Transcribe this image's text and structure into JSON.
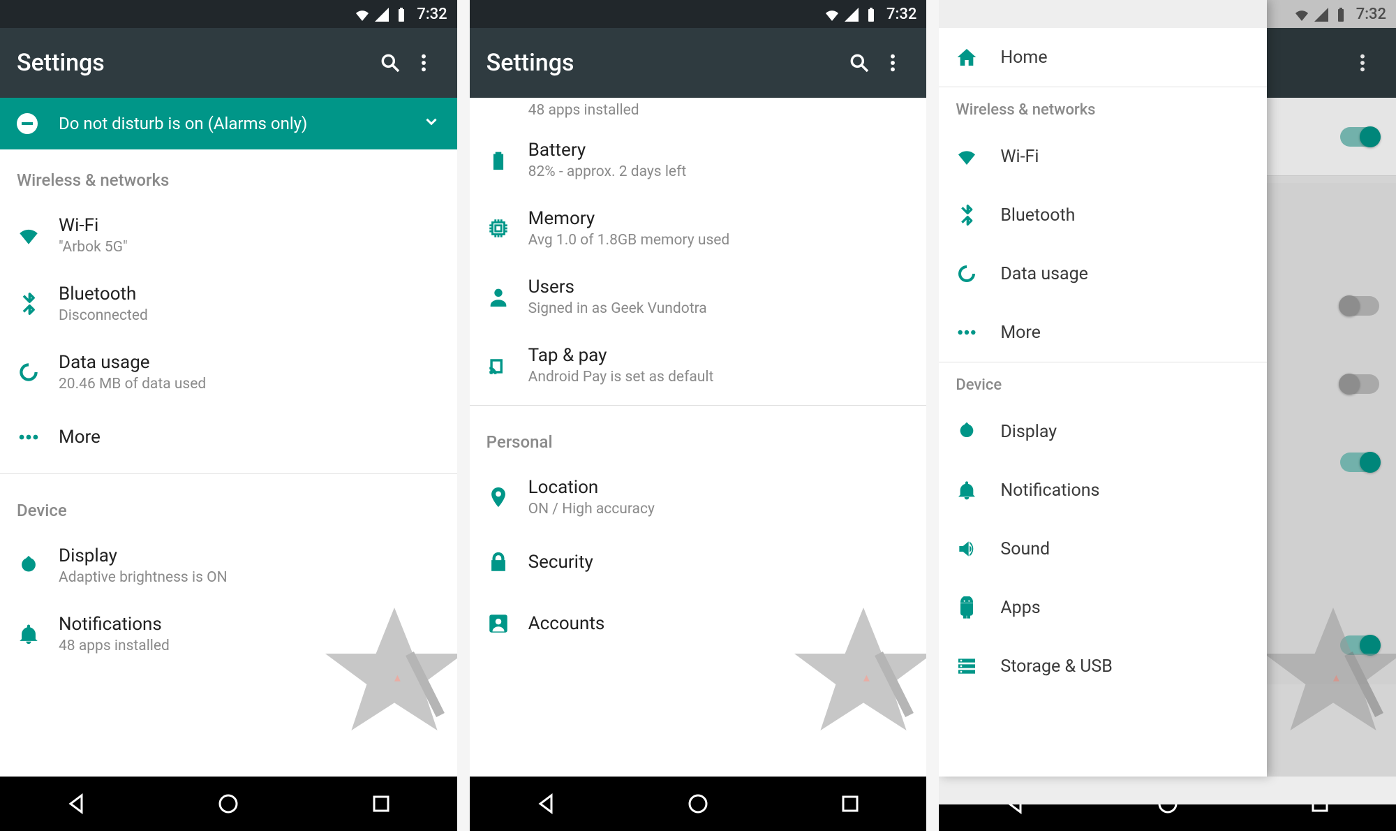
{
  "status": {
    "time": "7:32"
  },
  "appbar": {
    "title": "Settings"
  },
  "dnd": {
    "text": "Do not disturb is on (Alarms only)"
  },
  "p1": {
    "sections": {
      "wireless": "Wireless & networks",
      "device": "Device"
    },
    "wifi": {
      "title": "Wi-Fi",
      "sub": "\"Arbok 5G\""
    },
    "bt": {
      "title": "Bluetooth",
      "sub": "Disconnected"
    },
    "data": {
      "title": "Data usage",
      "sub": "20.46 MB of data used"
    },
    "more": {
      "title": "More"
    },
    "display": {
      "title": "Display",
      "sub": "Adaptive brightness is ON"
    },
    "notif": {
      "title": "Notifications",
      "sub": "48 apps installed"
    }
  },
  "p2": {
    "truncated_top": "48 apps installed",
    "battery": {
      "title": "Battery",
      "sub": "82% - approx. 2 days left"
    },
    "memory": {
      "title": "Memory",
      "sub": "Avg 1.0 of 1.8GB memory used"
    },
    "users": {
      "title": "Users",
      "sub": "Signed in as Geek Vundotra"
    },
    "tap": {
      "title": "Tap & pay",
      "sub": "Android Pay is set as default"
    },
    "personal_header": "Personal",
    "location": {
      "title": "Location",
      "sub": "ON / High accuracy"
    },
    "security": {
      "title": "Security"
    },
    "accounts": {
      "title": "Accounts"
    }
  },
  "p3": {
    "drawer": {
      "home": "Home",
      "wireless_header": "Wireless & networks",
      "wifi": "Wi-Fi",
      "bt": "Bluetooth",
      "data": "Data usage",
      "more": "More",
      "device_header": "Device",
      "display": "Display",
      "notif": "Notifications",
      "sound": "Sound",
      "apps": "Apps",
      "storage": "Storage & USB"
    }
  }
}
